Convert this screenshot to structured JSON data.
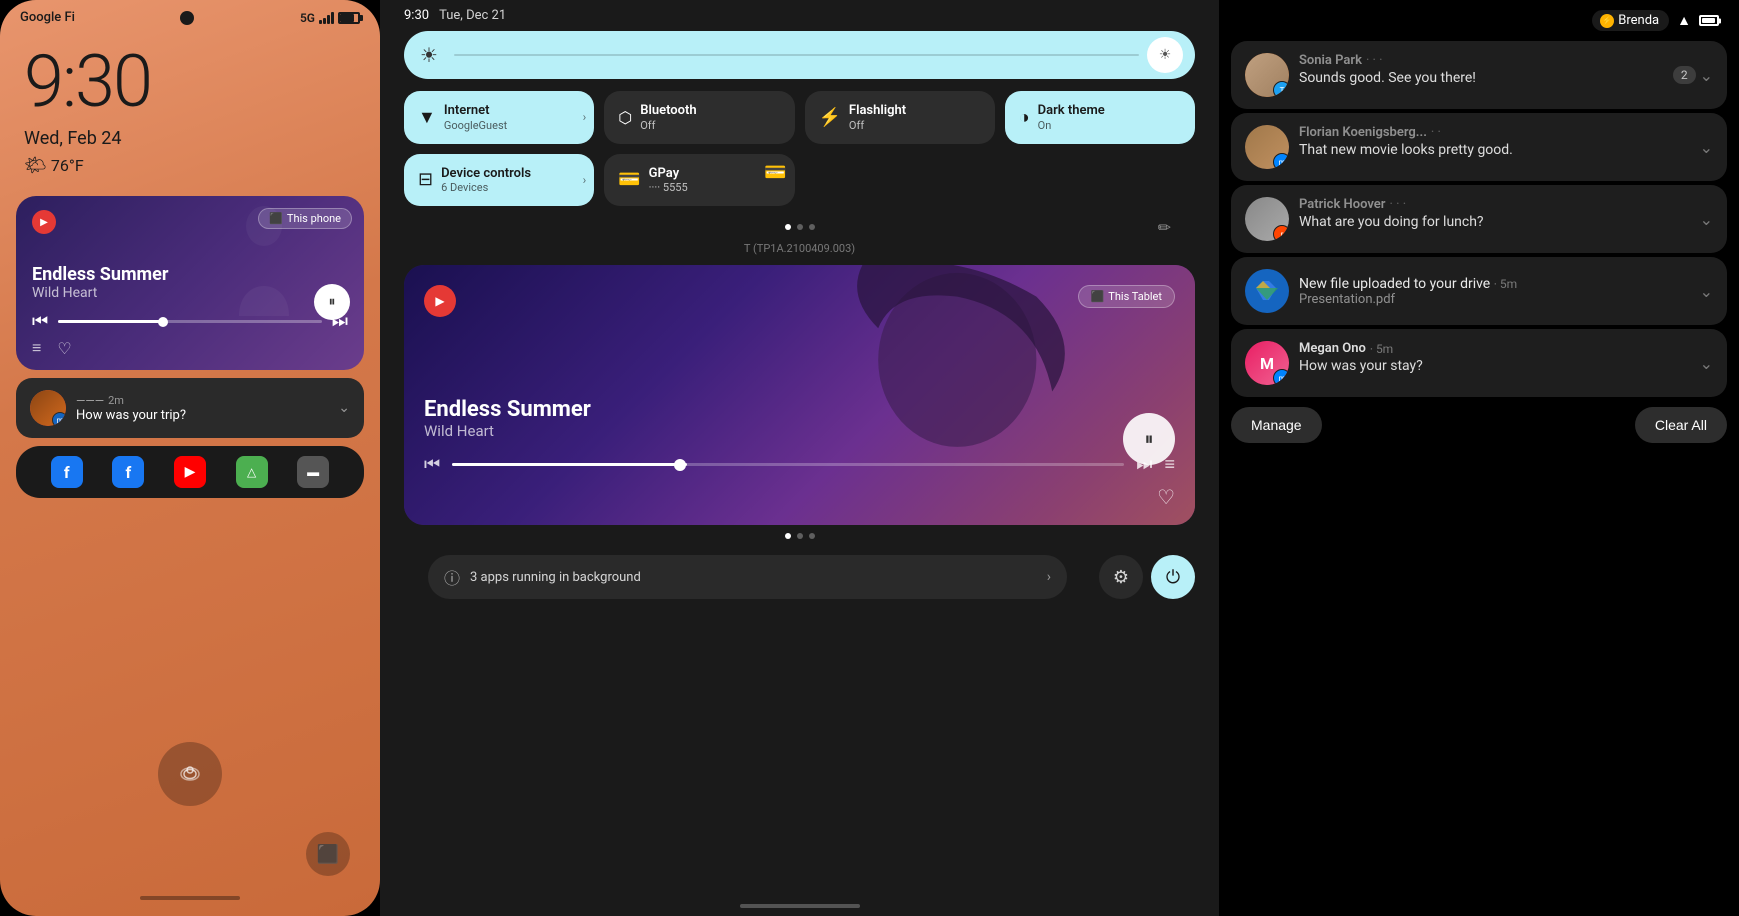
{
  "phone": {
    "carrier": "Google Fi",
    "network": "5G",
    "time": "9:30",
    "date": "Wed, Feb 24",
    "weather_icon": "🌤",
    "weather_temp": "76°F",
    "music": {
      "song_title": "Endless Summer",
      "song_artist": "Wild Heart",
      "badge_text": "This phone",
      "badge_icon": "▶"
    },
    "notification": {
      "sender": "---",
      "time": "2m",
      "message": "How was your trip?",
      "badge_type": "messenger"
    },
    "dock_icons": [
      "f",
      "F",
      "▶",
      "△",
      "▬"
    ]
  },
  "tablet": {
    "time": "9:30",
    "date": "Tue, Dec 21",
    "quick_settings": {
      "brightness_label": "Brightness",
      "tiles": [
        {
          "id": "internet",
          "icon": "▼",
          "title": "Internet",
          "subtitle": "GoogleGuest",
          "active": true,
          "has_chevron": true
        },
        {
          "id": "bluetooth",
          "icon": "◈",
          "title": "Bluetooth",
          "subtitle": "Off",
          "active": false,
          "has_chevron": false
        },
        {
          "id": "flashlight",
          "icon": "⚡",
          "title": "Flashlight",
          "subtitle": "Off",
          "active": false,
          "has_chevron": false
        },
        {
          "id": "dark_theme",
          "icon": "◑",
          "title": "Dark theme",
          "subtitle": "On",
          "active": true,
          "has_chevron": false
        },
        {
          "id": "device_controls",
          "icon": "⊟",
          "title": "Device controls",
          "subtitle": "6 Devices",
          "active": true,
          "has_chevron": true
        },
        {
          "id": "gpay",
          "icon": "⊡",
          "title": "GPay",
          "subtitle": "···· 5555",
          "active": false,
          "has_chevron": false
        }
      ]
    },
    "build_info": "T (TP1A.2100409.003)",
    "music": {
      "song_title": "Endless Summer",
      "song_artist": "Wild Heart",
      "badge_text": "This Tablet",
      "badge_icon": "▶"
    },
    "background_apps": {
      "label": "3 apps running in background",
      "settings_icon": "⚙",
      "power_icon": "⏻"
    }
  },
  "notifications": {
    "status_name": "Brenda",
    "status_charging": "⚡",
    "items": [
      {
        "id": "sonia",
        "sender": "Sonia Park",
        "sender_blurred": true,
        "message": "Sounds good. See you there!",
        "app": "twitter",
        "has_count": true,
        "count": "2",
        "expand_icon": "⌄"
      },
      {
        "id": "florian",
        "sender": "Florian Koenigsberg...",
        "sender_blurred": true,
        "message": "That new movie looks pretty good.",
        "app": "messenger",
        "has_count": false,
        "expand_icon": "⌄"
      },
      {
        "id": "patrick",
        "sender": "Patrick Hoover",
        "sender_blurred": true,
        "message": "What are you doing for lunch?",
        "app": "reddit",
        "has_count": false,
        "expand_icon": "⌄"
      },
      {
        "id": "drive",
        "sender": "New file uploaded to your drive",
        "time": "5m",
        "message": "Presentation.pdf",
        "app": "drive",
        "has_count": false,
        "expand_icon": "⌄"
      },
      {
        "id": "megan",
        "sender": "Megan Ono",
        "time": "5m",
        "message": "How was your stay?",
        "app": "messenger",
        "has_count": false,
        "expand_icon": "⌄"
      }
    ],
    "manage_label": "Manage",
    "clear_all_label": "Clear All"
  }
}
